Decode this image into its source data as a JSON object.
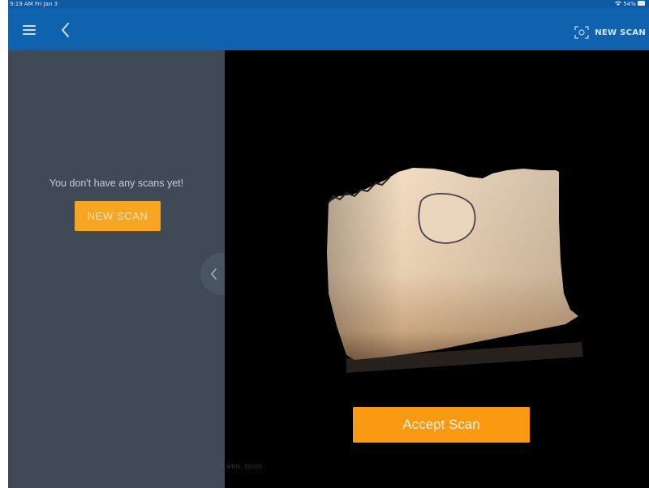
{
  "status_bar": {
    "time_date": "9:19 AM  Fri Jan 3",
    "battery": "54%"
  },
  "navbar": {
    "menu_icon": "hamburger-menu-icon",
    "back_icon": "chevron-left-icon",
    "new_scan_label": "NEW SCAN",
    "new_scan_icon": "scan-frame-icon"
  },
  "sidebar": {
    "empty_message": "You don't have any scans yet!",
    "new_scan_label": "NEW SCAN",
    "collapse_icon": "chevron-left-icon"
  },
  "viewer": {
    "accept_label": "Accept Scan",
    "mrn_text": "MRN: 00000"
  },
  "colors": {
    "nav_blue": "#0f62ae",
    "sidebar_gray": "#3f4a56",
    "accent_orange": "#f99a12",
    "viewer_bg": "#000000"
  }
}
